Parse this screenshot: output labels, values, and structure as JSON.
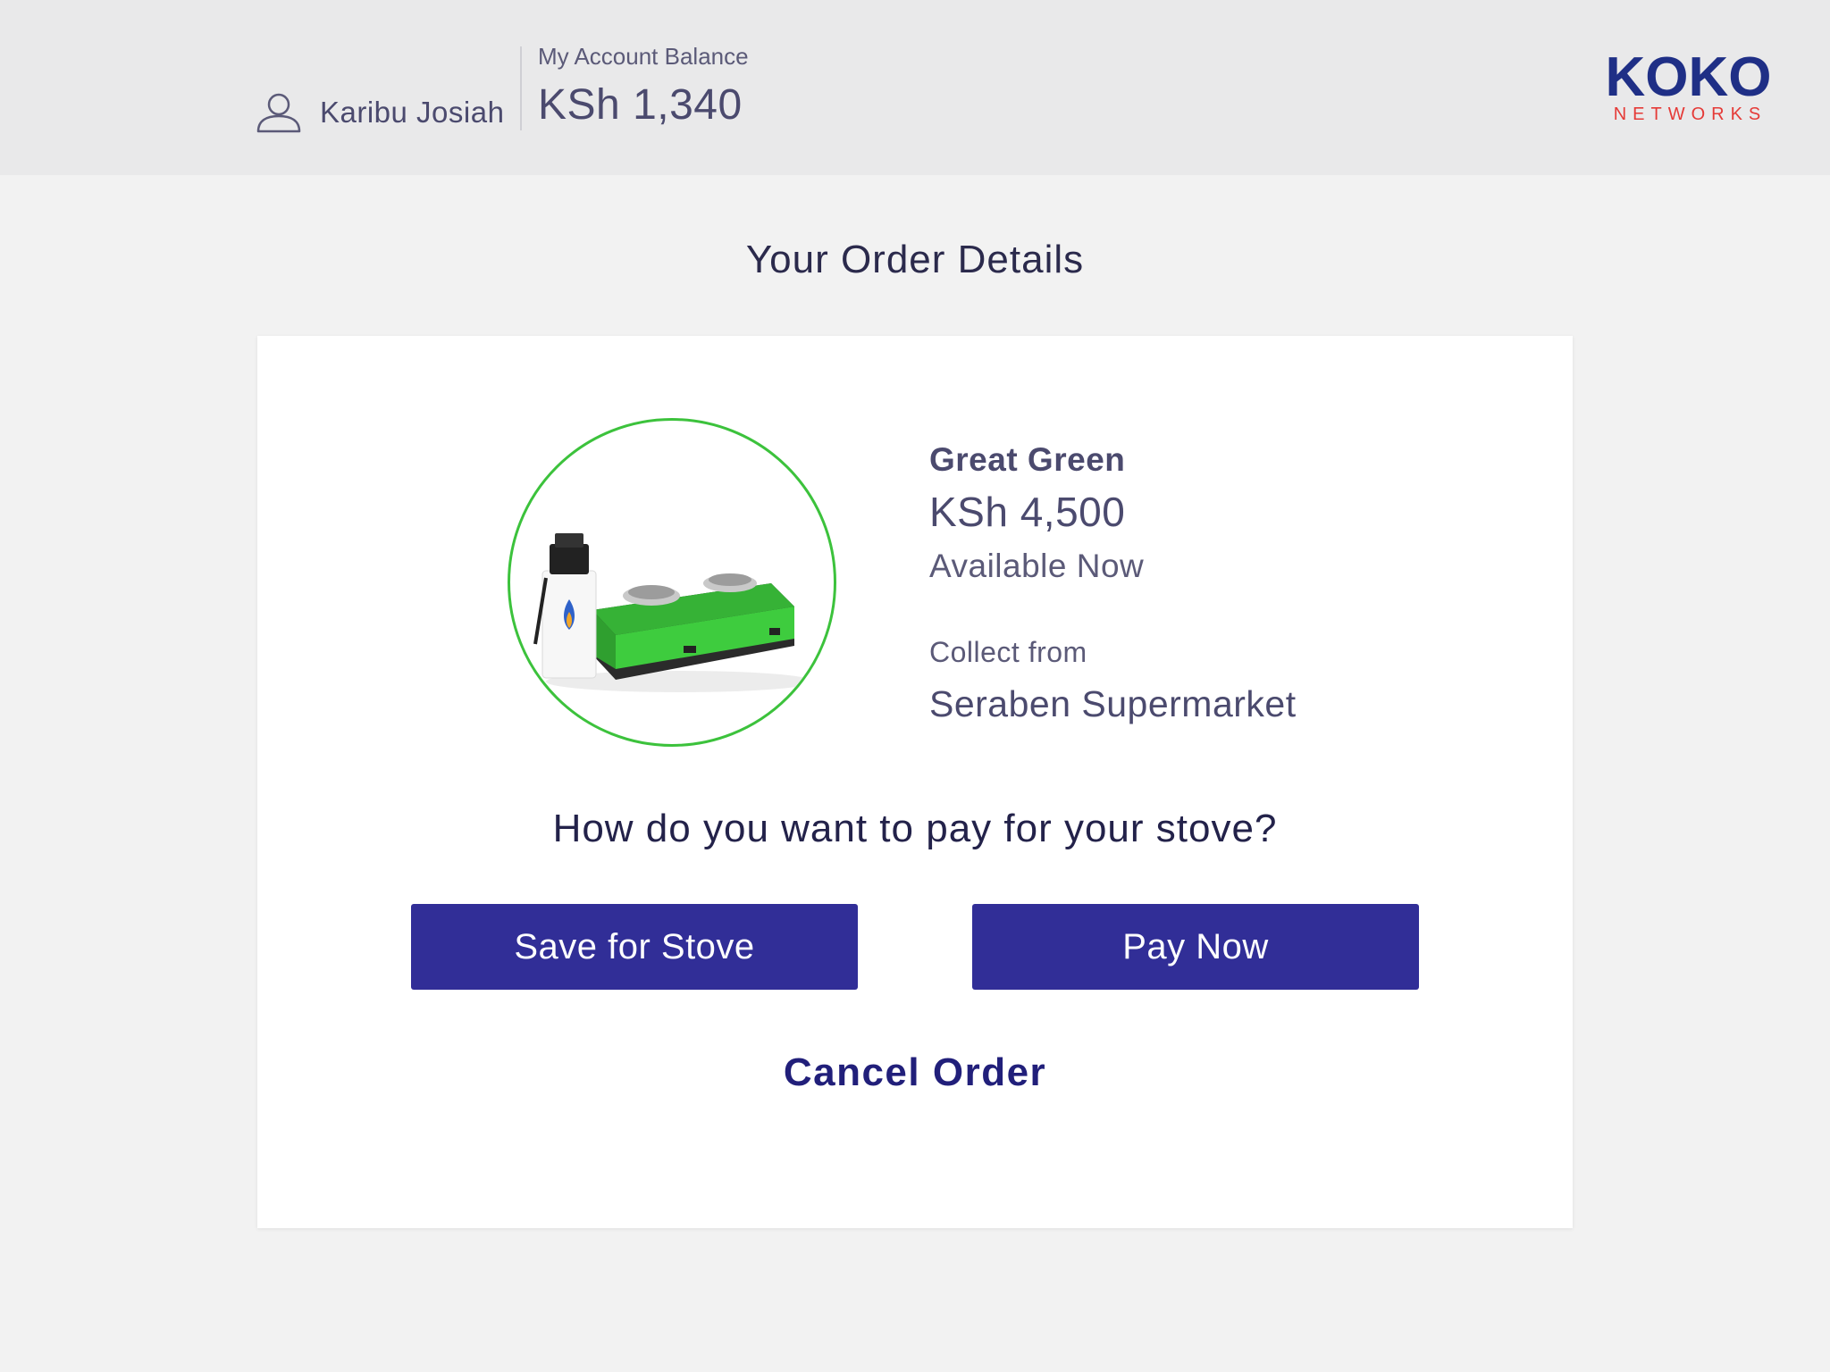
{
  "header": {
    "user_icon": "user-icon",
    "user_name": "Karibu Josiah",
    "balance_label": "My Account Balance",
    "balance_value": "KSh 1,340",
    "logo": {
      "primary": "KOKO",
      "secondary": "NETWORKS"
    }
  },
  "page": {
    "title": "Your Order Details"
  },
  "product": {
    "image": "stove-product-image",
    "name": "Great Green",
    "price": "KSh 4,500",
    "availability": "Available Now",
    "collect_label": "Collect from",
    "collect_location": "Seraben Supermarket"
  },
  "payment": {
    "question": "How do you want to pay for your stove?",
    "save_label": "Save for Stove",
    "pay_label": "Pay Now",
    "cancel_label": "Cancel Order"
  },
  "colors": {
    "header_bg": "#e9e9ea",
    "page_bg": "#f2f2f2",
    "button_bg": "#312e97",
    "logo_blue": "#1f2f86",
    "logo_red": "#e53a37",
    "circle_border": "#3cc23c"
  }
}
